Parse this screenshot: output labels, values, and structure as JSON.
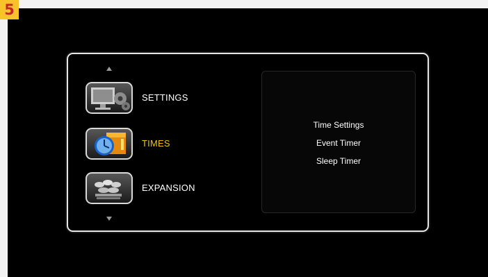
{
  "badge": {
    "number": "5"
  },
  "menu": {
    "items": [
      {
        "label": "SETTINGS",
        "icon": "settings-monitor-gears-icon",
        "selected": false
      },
      {
        "label": "TIMES",
        "icon": "clock-calendar-icon",
        "selected": true
      },
      {
        "label": "EXPANSION",
        "icon": "expansion-icon",
        "selected": false
      }
    ],
    "selected_color": "#f2c20f",
    "text_color": "#ffffff"
  },
  "submenu": {
    "items": [
      {
        "label": "Time Settings"
      },
      {
        "label": "Event Timer"
      },
      {
        "label": "Sleep Timer"
      }
    ]
  },
  "colors": {
    "badge_bg": "#f7c22a",
    "badge_text": "#c62828",
    "screen_bg": "#000000",
    "page_bg": "#f3f3f3"
  }
}
